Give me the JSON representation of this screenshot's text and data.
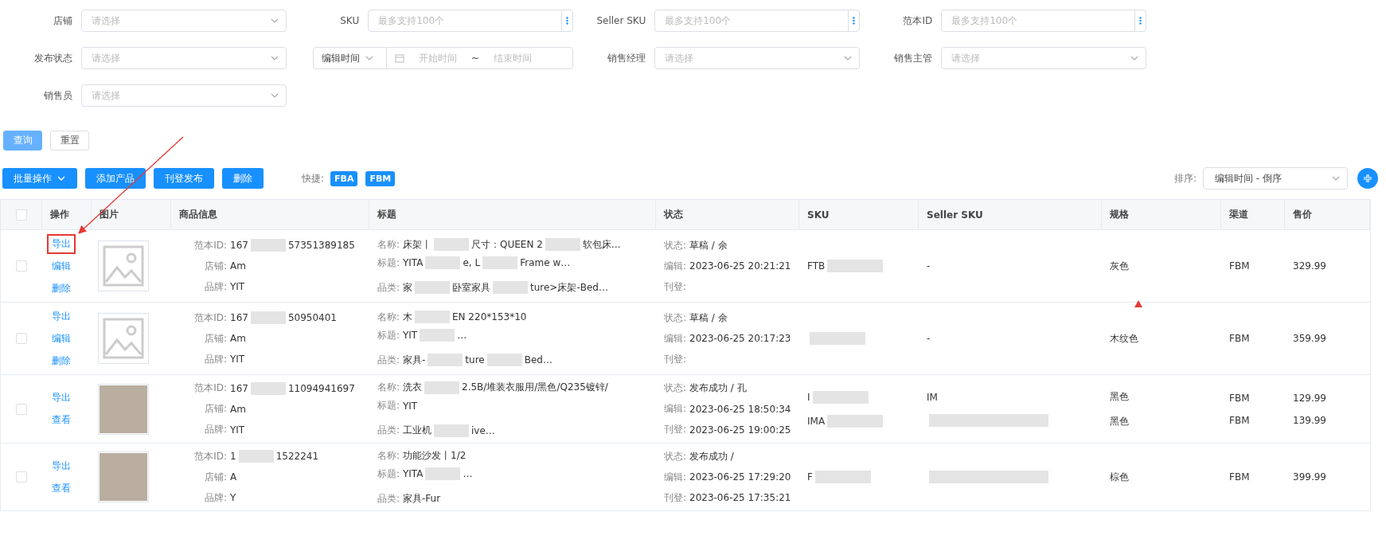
{
  "filters": [
    {
      "kind": "select",
      "label": "店铺",
      "placeholder": "请选择"
    },
    {
      "kind": "multi",
      "label": "SKU",
      "placeholder": "最多支持100个"
    },
    {
      "kind": "multi",
      "label": "Seller SKU",
      "placeholder": "最多支持100个"
    },
    {
      "kind": "multi",
      "label": "范本ID",
      "placeholder": "最多支持100个"
    },
    {
      "kind": "select",
      "label": "发布状态",
      "placeholder": "请选择"
    },
    {
      "kind": "daterange",
      "selector": "编辑时间",
      "start": "开始时间",
      "separator": "~",
      "end": "结束时间"
    },
    {
      "kind": "select",
      "label": "销售经理",
      "placeholder": "请选择"
    },
    {
      "kind": "select",
      "label": "销售主管",
      "placeholder": "请选择"
    },
    {
      "kind": "select",
      "label": "销售员",
      "placeholder": "请选择"
    }
  ],
  "search_buttons": [
    {
      "label": "查询",
      "kind": "primary"
    },
    {
      "label": "重置",
      "kind": "plain"
    }
  ],
  "toolbar": {
    "batch": "批量操作",
    "buttons": [
      "添加产品",
      "刊登发布",
      "删除"
    ],
    "quick_label": "快捷:",
    "quick_tags": [
      "FBA",
      "FBM"
    ],
    "sort_label": "排序:",
    "sort_value": "编辑时间 - 倒序"
  },
  "table": {
    "columns": [
      "操作",
      "图片",
      "商品信息",
      "标题",
      "状态",
      "SKU",
      "Seller SKU",
      "规格",
      "渠道",
      "售价"
    ],
    "all_checked": false,
    "rows": [
      {
        "checked": false,
        "actions": [
          {
            "label": "导出",
            "highlighted": true
          },
          {
            "label": "编辑",
            "highlighted": false
          },
          {
            "label": "删除",
            "highlighted": false
          }
        ],
        "image": {
          "kind": "placeholder"
        },
        "info": [
          {
            "label": "范本ID:",
            "value": [
              "167",
              "57351389185"
            ]
          },
          {
            "label": "店铺:",
            "value": [
              "Am"
            ]
          },
          {
            "label": "品牌:",
            "value": [
              "YIT"
            ]
          }
        ],
        "title": [
          {
            "label": "名称:",
            "value": [
              "床架丨",
              "尺寸：QUEEN 2",
              "软包床…"
            ]
          },
          {
            "label": "标题:",
            "value": [
              "YITA",
              "e, L",
              "Frame w…"
            ]
          },
          {
            "label": "品类:",
            "value": [
              "家",
              "卧室家具",
              "ture>床架-Bed…"
            ]
          }
        ],
        "status": [
          {
            "label": "状态:",
            "value": [
              "草稿 / 余"
            ]
          },
          {
            "label": "编辑:",
            "value": [
              "2023-06-25 20:21:21"
            ]
          },
          {
            "label": "刊登:"
          }
        ],
        "variants": [
          {
            "sku": [
              "FTB"
            ],
            "seller_sku": [
              "-"
            ],
            "spec": "灰色",
            "channel": "FBM",
            "price": "329.99"
          }
        ]
      },
      {
        "checked": false,
        "actions": [
          {
            "label": "导出",
            "highlighted": false
          },
          {
            "label": "编辑",
            "highlighted": false
          },
          {
            "label": "删除",
            "highlighted": false
          }
        ],
        "image": {
          "kind": "placeholder"
        },
        "info": [
          {
            "label": "范本ID:",
            "value": [
              "167",
              "50950401"
            ]
          },
          {
            "label": "店铺:",
            "value": [
              "Am"
            ]
          },
          {
            "label": "品牌:",
            "value": [
              "YIT"
            ]
          }
        ],
        "title": [
          {
            "label": "名称:",
            "value": [
              "木",
              "EN 220*153*10"
            ]
          },
          {
            "label": "标题:",
            "value": [
              "YIT",
              "…"
            ]
          },
          {
            "label": "品类:",
            "value": [
              "家具-",
              "ture",
              "Bed…"
            ]
          }
        ],
        "status": [
          {
            "label": "状态:",
            "value": [
              "草稿 / 余"
            ]
          },
          {
            "label": "编辑:",
            "value": [
              "2023-06-25 20:17:23"
            ]
          },
          {
            "label": "刊登:"
          }
        ],
        "variants": [
          {
            "seller_sku": [
              "-"
            ],
            "spec": "木纹色",
            "channel": "FBM",
            "price": "359.99"
          }
        ]
      },
      {
        "checked": false,
        "actions": [
          {
            "label": "导出",
            "highlighted": false
          },
          {
            "label": "查看",
            "highlighted": false
          }
        ],
        "image": {
          "kind": "photo"
        },
        "info": [
          {
            "label": "范本ID:",
            "value": [
              "167",
              "11094941697"
            ]
          },
          {
            "label": "店铺:",
            "value": [
              "Am"
            ]
          },
          {
            "label": "品牌:",
            "value": [
              "YIT"
            ]
          }
        ],
        "title": [
          {
            "label": "名称:",
            "value": [
              "洗衣",
              "2.5B/堆装衣服用/黑色/Q235镀锌/"
            ]
          },
          {
            "label": "标题:",
            "value": [
              "YIT"
            ]
          },
          {
            "label": "品类:",
            "value": [
              "工业机",
              "ive…"
            ]
          }
        ],
        "status": [
          {
            "label": "状态:",
            "value": [
              "发布成功 / 孔"
            ]
          },
          {
            "label": "编辑:",
            "value": [
              "2023-06-25 18:50:34"
            ]
          },
          {
            "label": "刊登:",
            "value": [
              "2023-06-25 19:00:25"
            ]
          }
        ],
        "variants": [
          {
            "sku": [
              "I"
            ],
            "seller_sku": [
              "IM"
            ],
            "spec": "黑色",
            "channel": "FBM",
            "price": "129.99"
          },
          {
            "sku": [
              "IMA"
            ],
            "spec": "黑色",
            "channel": "FBM",
            "price": "139.99"
          }
        ]
      },
      {
        "checked": false,
        "actions": [
          {
            "label": "导出",
            "highlighted": false
          },
          {
            "label": "查看",
            "highlighted": false
          }
        ],
        "image": {
          "kind": "photo"
        },
        "info": [
          {
            "label": "范本ID:",
            "value": [
              "1",
              "1522241"
            ]
          },
          {
            "label": "店铺:",
            "value": [
              "A"
            ]
          },
          {
            "label": "品牌:",
            "value": [
              "Y"
            ]
          }
        ],
        "title": [
          {
            "label": "名称:",
            "value": [
              "功能沙发丨1/2"
            ]
          },
          {
            "label": "标题:",
            "value": [
              "YITA",
              "…"
            ]
          },
          {
            "label": "品类:",
            "value": [
              "家具-Fur"
            ]
          }
        ],
        "status": [
          {
            "label": "状态:",
            "value": [
              "发布成功 / "
            ]
          },
          {
            "label": "编辑:",
            "value": [
              "2023-06-25 17:29:20"
            ]
          },
          {
            "label": "刊登:",
            "value": [
              "2023-06-25 17:35:21"
            ]
          }
        ],
        "variants": [
          {
            "sku": [
              "F"
            ],
            "spec": "棕色",
            "channel": "FBM",
            "price": "399.99"
          }
        ]
      }
    ]
  },
  "annotations": {
    "arrow": true,
    "marker": true
  }
}
